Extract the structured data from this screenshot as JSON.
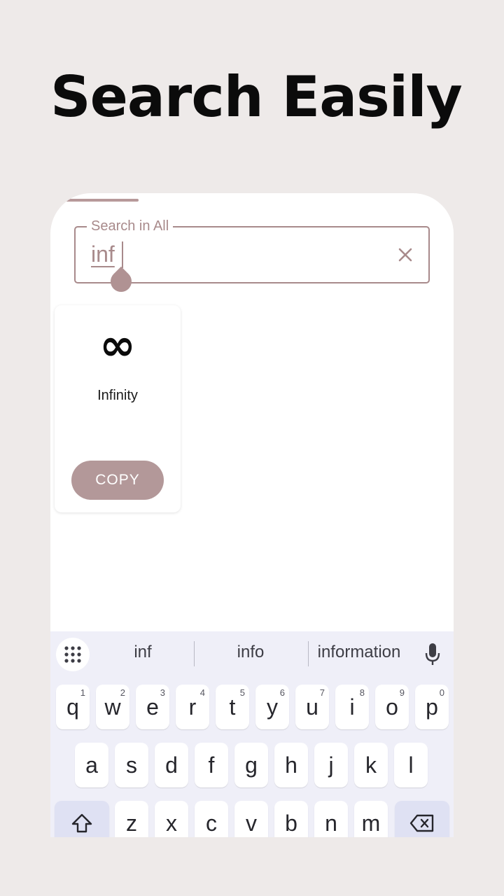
{
  "headline": "Search Easily",
  "search": {
    "label": "Search in All",
    "value": "inf",
    "clear_icon": "close-icon"
  },
  "result": {
    "symbol": "∞",
    "name": "Infinity",
    "copy_label": "COPY"
  },
  "keyboard": {
    "suggestions": [
      "inf",
      "info",
      "information"
    ],
    "row1": [
      {
        "k": "q",
        "n": "1"
      },
      {
        "k": "w",
        "n": "2"
      },
      {
        "k": "e",
        "n": "3"
      },
      {
        "k": "r",
        "n": "4"
      },
      {
        "k": "t",
        "n": "5"
      },
      {
        "k": "y",
        "n": "6"
      },
      {
        "k": "u",
        "n": "7"
      },
      {
        "k": "i",
        "n": "8"
      },
      {
        "k": "o",
        "n": "9"
      },
      {
        "k": "p",
        "n": "0"
      }
    ],
    "row2": [
      "a",
      "s",
      "d",
      "f",
      "g",
      "h",
      "j",
      "k",
      "l"
    ],
    "row3": [
      "z",
      "x",
      "c",
      "v",
      "b",
      "n",
      "m"
    ]
  },
  "colors": {
    "accent": "#a88a8b",
    "copy_button": "#b39899",
    "background": "#eeeae9",
    "keyboard": "#efeff8"
  }
}
